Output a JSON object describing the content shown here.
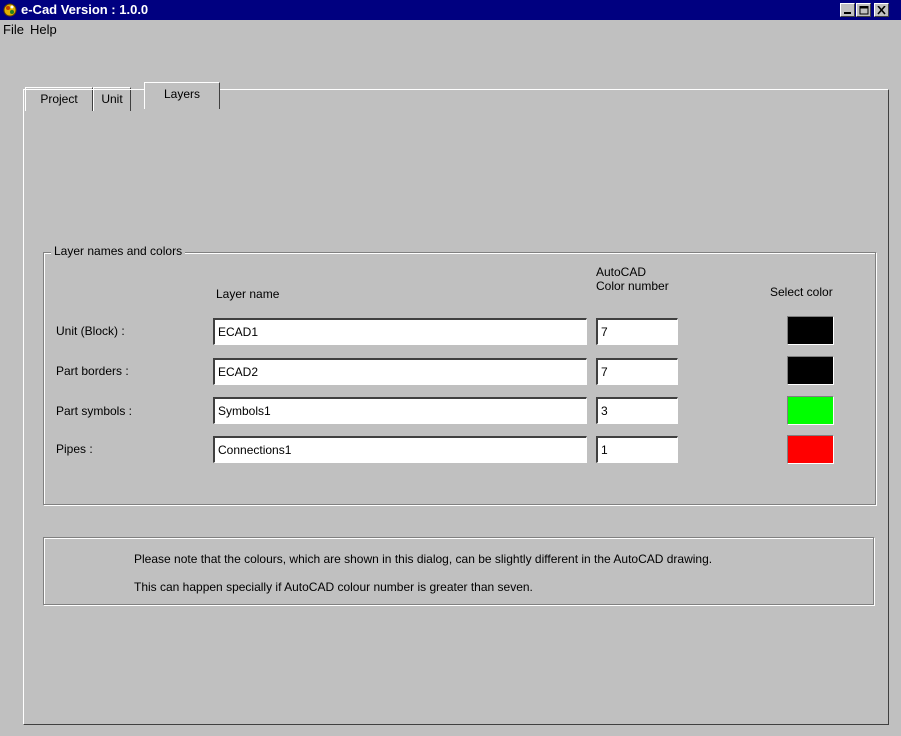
{
  "window": {
    "title": "e-Cad  Version : 1.0.0"
  },
  "menu": {
    "items": [
      "File",
      "Help"
    ]
  },
  "tabs": [
    {
      "label": "Project",
      "active": false
    },
    {
      "label": "Unit",
      "active": false
    },
    {
      "label": "Layers",
      "active": true
    }
  ],
  "layers": {
    "group_title": "Layer names and colors",
    "columns": {
      "layer_name": "Layer name",
      "color_number_line1": "AutoCAD",
      "color_number_line2": "Color number",
      "select_color": "Select color"
    },
    "rows": [
      {
        "label": "Unit  (Block) :",
        "layer_name": "ECAD1",
        "color_number": "7",
        "swatch_color": "#000000"
      },
      {
        "label": "Part borders :",
        "layer_name": "ECAD2",
        "color_number": "7",
        "swatch_color": "#000000"
      },
      {
        "label": "Part symbols :",
        "layer_name": "Symbols1",
        "color_number": "3",
        "swatch_color": "#00ff00"
      },
      {
        "label": "Pipes :",
        "layer_name": "Connections1",
        "color_number": "1",
        "swatch_color": "#ff0000"
      }
    ]
  },
  "note": {
    "line1": "Please note that the colours, which are shown in this dialog, can be slightly different  in the AutoCAD drawing.",
    "line2": "This can happen specially  if AutoCAD colour number is greater than seven."
  },
  "colors": {
    "titlebar": "#000080",
    "face": "#c0c0c0"
  }
}
